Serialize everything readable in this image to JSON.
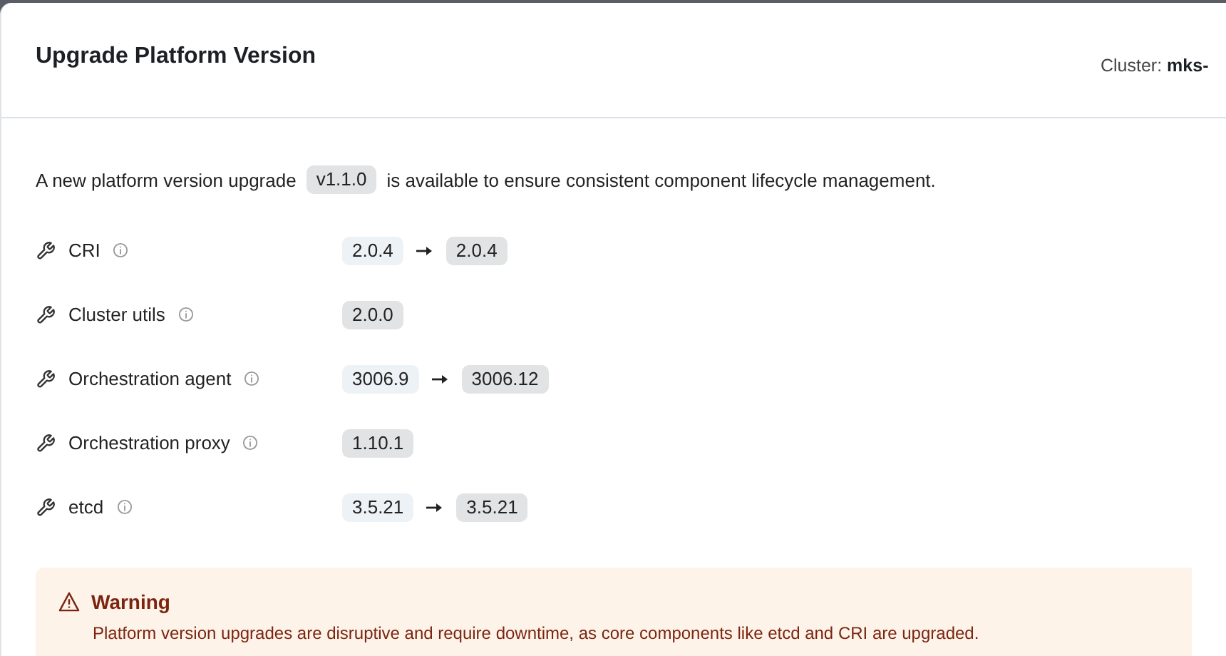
{
  "dialog": {
    "title": "Upgrade Platform Version",
    "cluster_label": "Cluster:",
    "cluster_name": "mks-"
  },
  "intro": {
    "before": "A new platform version upgrade",
    "version": "v1.1.0",
    "after": "is available to ensure consistent component lifecycle management."
  },
  "components": [
    {
      "name": "CRI",
      "versions": [
        {
          "text": "2.0.4",
          "kind": "current"
        },
        {
          "text": "2.0.4",
          "kind": "target"
        }
      ]
    },
    {
      "name": "Cluster utils",
      "versions": [
        {
          "text": "2.0.0",
          "kind": "target"
        }
      ]
    },
    {
      "name": "Orchestration agent",
      "versions": [
        {
          "text": "3006.9",
          "kind": "current"
        },
        {
          "text": "3006.12",
          "kind": "target"
        }
      ]
    },
    {
      "name": "Orchestration proxy",
      "versions": [
        {
          "text": "1.10.1",
          "kind": "target"
        }
      ]
    },
    {
      "name": "etcd",
      "versions": [
        {
          "text": "3.5.21",
          "kind": "current"
        },
        {
          "text": "3.5.21",
          "kind": "target"
        }
      ]
    }
  ],
  "warning": {
    "title": "Warning",
    "message": "Platform version upgrades are disruptive and require downtime, as core components like etcd and CRI are upgraded."
  }
}
